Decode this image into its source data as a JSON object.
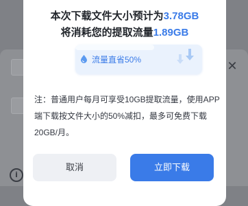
{
  "background": {
    "close_glyph": "✕",
    "info_glyph": "i"
  },
  "dialog": {
    "line1_prefix": "本次下载文件大小预计为",
    "line1_value": "3.78GB",
    "line2_prefix": "将消耗您的提取流量",
    "line2_value": "1.89GB",
    "banner_label": "流量直省50%",
    "note": "注：普通用户每月可享受10GB提取流量，使用APP端下载按文件大小的50%减扣，最多可免费下载20GB/月。",
    "cancel_label": "取消",
    "confirm_label": "立即下载"
  },
  "colors": {
    "accent": "#3a7be8",
    "overlay": "#7f8186"
  }
}
